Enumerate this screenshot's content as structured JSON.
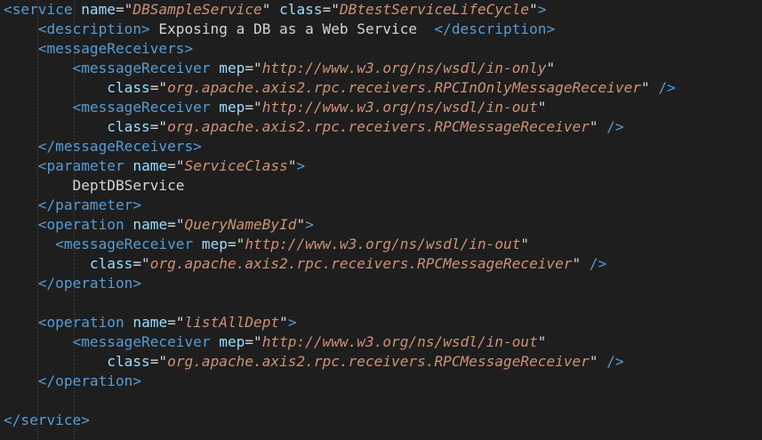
{
  "editor": {
    "lines": [
      {
        "segments": [
          {
            "c": "t",
            "s": "<service"
          },
          {
            "c": "p",
            "s": " "
          },
          {
            "c": "a",
            "s": "name"
          },
          {
            "c": "p",
            "s": "=\""
          },
          {
            "c": "v",
            "s": "DBSampleService"
          },
          {
            "c": "p",
            "s": "\" "
          },
          {
            "c": "a",
            "s": "class"
          },
          {
            "c": "p",
            "s": "=\""
          },
          {
            "c": "v",
            "s": "DBtestServiceLifeCycle"
          },
          {
            "c": "p",
            "s": "\""
          },
          {
            "c": "t",
            "s": ">"
          }
        ]
      },
      {
        "segments": [
          {
            "c": "p",
            "s": "    "
          },
          {
            "c": "t",
            "s": "<description>"
          },
          {
            "c": "txt",
            "s": " Exposing a DB as a Web Service  "
          },
          {
            "c": "t",
            "s": "</description>"
          }
        ]
      },
      {
        "segments": [
          {
            "c": "p",
            "s": "    "
          },
          {
            "c": "t",
            "s": "<messageReceivers>"
          }
        ]
      },
      {
        "segments": [
          {
            "c": "p",
            "s": "        "
          },
          {
            "c": "t",
            "s": "<messageReceiver"
          },
          {
            "c": "p",
            "s": " "
          },
          {
            "c": "a",
            "s": "mep"
          },
          {
            "c": "p",
            "s": "=\""
          },
          {
            "c": "v",
            "s": "http://www.w3.org/ns/wsdl/in-only"
          },
          {
            "c": "p",
            "s": "\""
          }
        ]
      },
      {
        "segments": [
          {
            "c": "p",
            "s": "            "
          },
          {
            "c": "a",
            "s": "class"
          },
          {
            "c": "p",
            "s": "=\""
          },
          {
            "c": "v",
            "s": "org.apache.axis2.rpc.receivers.RPCInOnlyMessageReceiver"
          },
          {
            "c": "p",
            "s": "\" "
          },
          {
            "c": "t",
            "s": "/>"
          }
        ]
      },
      {
        "segments": [
          {
            "c": "p",
            "s": "        "
          },
          {
            "c": "t",
            "s": "<messageReceiver"
          },
          {
            "c": "p",
            "s": " "
          },
          {
            "c": "a",
            "s": "mep"
          },
          {
            "c": "p",
            "s": "=\""
          },
          {
            "c": "v",
            "s": "http://www.w3.org/ns/wsdl/in-out"
          },
          {
            "c": "p",
            "s": "\""
          }
        ]
      },
      {
        "segments": [
          {
            "c": "p",
            "s": "            "
          },
          {
            "c": "a",
            "s": "class"
          },
          {
            "c": "p",
            "s": "=\""
          },
          {
            "c": "v",
            "s": "org.apache.axis2.rpc.receivers.RPCMessageReceiver"
          },
          {
            "c": "p",
            "s": "\" "
          },
          {
            "c": "t",
            "s": "/>"
          }
        ]
      },
      {
        "segments": [
          {
            "c": "p",
            "s": "    "
          },
          {
            "c": "t",
            "s": "</messageReceivers>"
          }
        ]
      },
      {
        "segments": [
          {
            "c": "p",
            "s": "    "
          },
          {
            "c": "t",
            "s": "<parameter"
          },
          {
            "c": "p",
            "s": " "
          },
          {
            "c": "a",
            "s": "name"
          },
          {
            "c": "p",
            "s": "=\""
          },
          {
            "c": "v",
            "s": "ServiceClass"
          },
          {
            "c": "p",
            "s": "\""
          },
          {
            "c": "t",
            "s": ">"
          }
        ]
      },
      {
        "segments": [
          {
            "c": "txt",
            "s": "        DeptDBService"
          }
        ]
      },
      {
        "segments": [
          {
            "c": "p",
            "s": "    "
          },
          {
            "c": "t",
            "s": "</parameter>"
          }
        ]
      },
      {
        "segments": [
          {
            "c": "p",
            "s": "    "
          },
          {
            "c": "t",
            "s": "<operation"
          },
          {
            "c": "p",
            "s": " "
          },
          {
            "c": "a",
            "s": "name"
          },
          {
            "c": "p",
            "s": "=\""
          },
          {
            "c": "v",
            "s": "QueryNameById"
          },
          {
            "c": "p",
            "s": "\""
          },
          {
            "c": "t",
            "s": ">"
          }
        ]
      },
      {
        "segments": [
          {
            "c": "p",
            "s": "      "
          },
          {
            "c": "t",
            "s": "<messageReceiver"
          },
          {
            "c": "p",
            "s": " "
          },
          {
            "c": "a",
            "s": "mep"
          },
          {
            "c": "p",
            "s": "=\""
          },
          {
            "c": "v",
            "s": "http://www.w3.org/ns/wsdl/in-out"
          },
          {
            "c": "p",
            "s": "\""
          }
        ]
      },
      {
        "segments": [
          {
            "c": "p",
            "s": "          "
          },
          {
            "c": "a",
            "s": "class"
          },
          {
            "c": "p",
            "s": "=\""
          },
          {
            "c": "v",
            "s": "org.apache.axis2.rpc.receivers.RPCMessageReceiver"
          },
          {
            "c": "p",
            "s": "\" "
          },
          {
            "c": "t",
            "s": "/>"
          }
        ]
      },
      {
        "segments": [
          {
            "c": "p",
            "s": "    "
          },
          {
            "c": "t",
            "s": "</operation>"
          }
        ]
      },
      {
        "segments": []
      },
      {
        "segments": [
          {
            "c": "p",
            "s": "    "
          },
          {
            "c": "t",
            "s": "<operation"
          },
          {
            "c": "p",
            "s": " "
          },
          {
            "c": "a",
            "s": "name"
          },
          {
            "c": "p",
            "s": "=\""
          },
          {
            "c": "v",
            "s": "listAllDept"
          },
          {
            "c": "p",
            "s": "\""
          },
          {
            "c": "t",
            "s": ">"
          }
        ]
      },
      {
        "segments": [
          {
            "c": "p",
            "s": "        "
          },
          {
            "c": "t",
            "s": "<messageReceiver"
          },
          {
            "c": "p",
            "s": " "
          },
          {
            "c": "a",
            "s": "mep"
          },
          {
            "c": "p",
            "s": "=\""
          },
          {
            "c": "v",
            "s": "http://www.w3.org/ns/wsdl/in-out"
          },
          {
            "c": "p",
            "s": "\""
          }
        ]
      },
      {
        "segments": [
          {
            "c": "p",
            "s": "            "
          },
          {
            "c": "a",
            "s": "class"
          },
          {
            "c": "p",
            "s": "=\""
          },
          {
            "c": "v",
            "s": "org.apache.axis2.rpc.receivers.RPCMessageReceiver"
          },
          {
            "c": "p",
            "s": "\" "
          },
          {
            "c": "t",
            "s": "/>"
          }
        ]
      },
      {
        "segments": [
          {
            "c": "p",
            "s": "    "
          },
          {
            "c": "t",
            "s": "</operation>"
          }
        ]
      },
      {
        "segments": []
      },
      {
        "segments": [
          {
            "c": "t",
            "s": "</service>"
          }
        ]
      }
    ]
  },
  "colors": {
    "background": "#1e1e1e",
    "tag": "#569cd6",
    "attribute": "#9cdcfe",
    "value": "#ce9178",
    "text": "#d4d4d4"
  }
}
